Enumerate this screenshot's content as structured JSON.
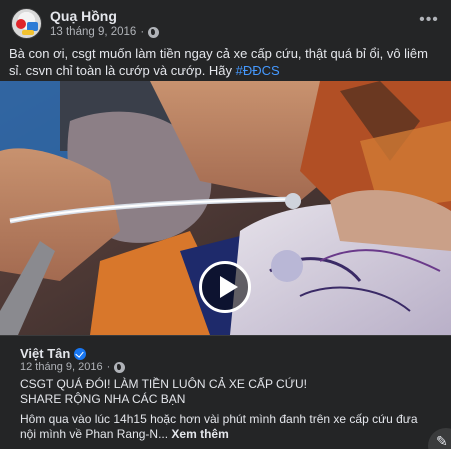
{
  "post": {
    "author": "Quạ Hồng",
    "date": "13 tháng 9, 2016",
    "dot": "·",
    "more_label": "•••",
    "text": "Bà con ơi, csgt muốn làm tiền ngay cả xe cấp cứu, thật quá bỉ ổi, vô liêm sỉ. csvn chỉ toàn là cướp và cướp. Hãy ",
    "hashtag": "#ĐĐCS"
  },
  "video": {
    "controls": [
      "settings-icon",
      "expand-icon",
      "pip-icon",
      "fullscreen-icon",
      "volume-icon"
    ]
  },
  "shared": {
    "author": "Việt Tân",
    "date": "12 tháng 9, 2016",
    "dot": "·",
    "headline1": "CSGT QUÁ ĐÓI! LÀM TIỀN LUÔN CẢ XE CẤP CỨU!",
    "headline2": "SHARE RỘNG NHA CÁC BẠN",
    "body": "Hôm qua vào lúc 14h15 hoặc hơn vài phút mình đanh trên xe cấp cứu đưa nội mình về Phan Rang-N...",
    "see_more": "Xem thêm"
  },
  "colors": {
    "background": "#242526",
    "text": "#e4e6eb",
    "secondary_text": "#b0b3b8",
    "hashtag": "#4599ff",
    "verified": "#1877f2"
  }
}
